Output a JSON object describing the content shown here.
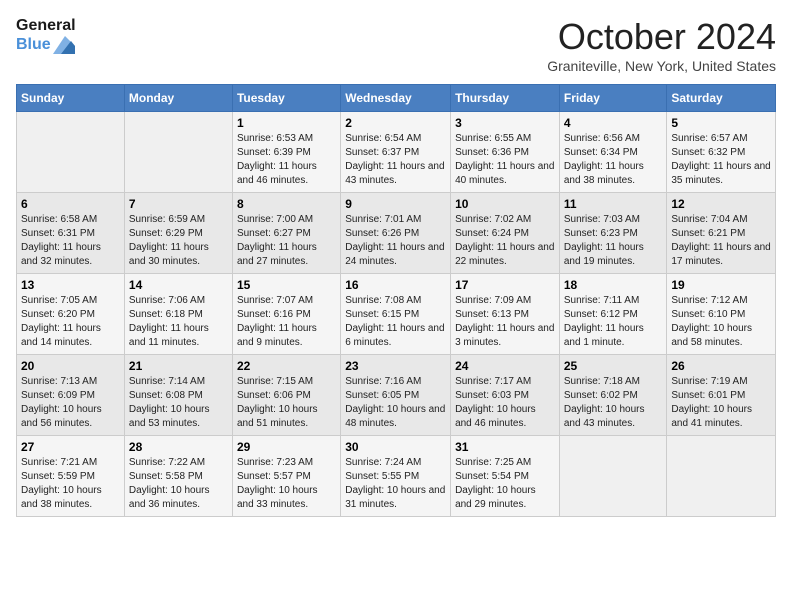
{
  "header": {
    "logo_line1": "General",
    "logo_line2": "Blue",
    "month": "October 2024",
    "location": "Graniteville, New York, United States"
  },
  "days_of_week": [
    "Sunday",
    "Monday",
    "Tuesday",
    "Wednesday",
    "Thursday",
    "Friday",
    "Saturday"
  ],
  "weeks": [
    [
      {
        "day": "",
        "info": ""
      },
      {
        "day": "",
        "info": ""
      },
      {
        "day": "1",
        "info": "Sunrise: 6:53 AM\nSunset: 6:39 PM\nDaylight: 11 hours and 46 minutes."
      },
      {
        "day": "2",
        "info": "Sunrise: 6:54 AM\nSunset: 6:37 PM\nDaylight: 11 hours and 43 minutes."
      },
      {
        "day": "3",
        "info": "Sunrise: 6:55 AM\nSunset: 6:36 PM\nDaylight: 11 hours and 40 minutes."
      },
      {
        "day": "4",
        "info": "Sunrise: 6:56 AM\nSunset: 6:34 PM\nDaylight: 11 hours and 38 minutes."
      },
      {
        "day": "5",
        "info": "Sunrise: 6:57 AM\nSunset: 6:32 PM\nDaylight: 11 hours and 35 minutes."
      }
    ],
    [
      {
        "day": "6",
        "info": "Sunrise: 6:58 AM\nSunset: 6:31 PM\nDaylight: 11 hours and 32 minutes."
      },
      {
        "day": "7",
        "info": "Sunrise: 6:59 AM\nSunset: 6:29 PM\nDaylight: 11 hours and 30 minutes."
      },
      {
        "day": "8",
        "info": "Sunrise: 7:00 AM\nSunset: 6:27 PM\nDaylight: 11 hours and 27 minutes."
      },
      {
        "day": "9",
        "info": "Sunrise: 7:01 AM\nSunset: 6:26 PM\nDaylight: 11 hours and 24 minutes."
      },
      {
        "day": "10",
        "info": "Sunrise: 7:02 AM\nSunset: 6:24 PM\nDaylight: 11 hours and 22 minutes."
      },
      {
        "day": "11",
        "info": "Sunrise: 7:03 AM\nSunset: 6:23 PM\nDaylight: 11 hours and 19 minutes."
      },
      {
        "day": "12",
        "info": "Sunrise: 7:04 AM\nSunset: 6:21 PM\nDaylight: 11 hours and 17 minutes."
      }
    ],
    [
      {
        "day": "13",
        "info": "Sunrise: 7:05 AM\nSunset: 6:20 PM\nDaylight: 11 hours and 14 minutes."
      },
      {
        "day": "14",
        "info": "Sunrise: 7:06 AM\nSunset: 6:18 PM\nDaylight: 11 hours and 11 minutes."
      },
      {
        "day": "15",
        "info": "Sunrise: 7:07 AM\nSunset: 6:16 PM\nDaylight: 11 hours and 9 minutes."
      },
      {
        "day": "16",
        "info": "Sunrise: 7:08 AM\nSunset: 6:15 PM\nDaylight: 11 hours and 6 minutes."
      },
      {
        "day": "17",
        "info": "Sunrise: 7:09 AM\nSunset: 6:13 PM\nDaylight: 11 hours and 3 minutes."
      },
      {
        "day": "18",
        "info": "Sunrise: 7:11 AM\nSunset: 6:12 PM\nDaylight: 11 hours and 1 minute."
      },
      {
        "day": "19",
        "info": "Sunrise: 7:12 AM\nSunset: 6:10 PM\nDaylight: 10 hours and 58 minutes."
      }
    ],
    [
      {
        "day": "20",
        "info": "Sunrise: 7:13 AM\nSunset: 6:09 PM\nDaylight: 10 hours and 56 minutes."
      },
      {
        "day": "21",
        "info": "Sunrise: 7:14 AM\nSunset: 6:08 PM\nDaylight: 10 hours and 53 minutes."
      },
      {
        "day": "22",
        "info": "Sunrise: 7:15 AM\nSunset: 6:06 PM\nDaylight: 10 hours and 51 minutes."
      },
      {
        "day": "23",
        "info": "Sunrise: 7:16 AM\nSunset: 6:05 PM\nDaylight: 10 hours and 48 minutes."
      },
      {
        "day": "24",
        "info": "Sunrise: 7:17 AM\nSunset: 6:03 PM\nDaylight: 10 hours and 46 minutes."
      },
      {
        "day": "25",
        "info": "Sunrise: 7:18 AM\nSunset: 6:02 PM\nDaylight: 10 hours and 43 minutes."
      },
      {
        "day": "26",
        "info": "Sunrise: 7:19 AM\nSunset: 6:01 PM\nDaylight: 10 hours and 41 minutes."
      }
    ],
    [
      {
        "day": "27",
        "info": "Sunrise: 7:21 AM\nSunset: 5:59 PM\nDaylight: 10 hours and 38 minutes."
      },
      {
        "day": "28",
        "info": "Sunrise: 7:22 AM\nSunset: 5:58 PM\nDaylight: 10 hours and 36 minutes."
      },
      {
        "day": "29",
        "info": "Sunrise: 7:23 AM\nSunset: 5:57 PM\nDaylight: 10 hours and 33 minutes."
      },
      {
        "day": "30",
        "info": "Sunrise: 7:24 AM\nSunset: 5:55 PM\nDaylight: 10 hours and 31 minutes."
      },
      {
        "day": "31",
        "info": "Sunrise: 7:25 AM\nSunset: 5:54 PM\nDaylight: 10 hours and 29 minutes."
      },
      {
        "day": "",
        "info": ""
      },
      {
        "day": "",
        "info": ""
      }
    ]
  ]
}
